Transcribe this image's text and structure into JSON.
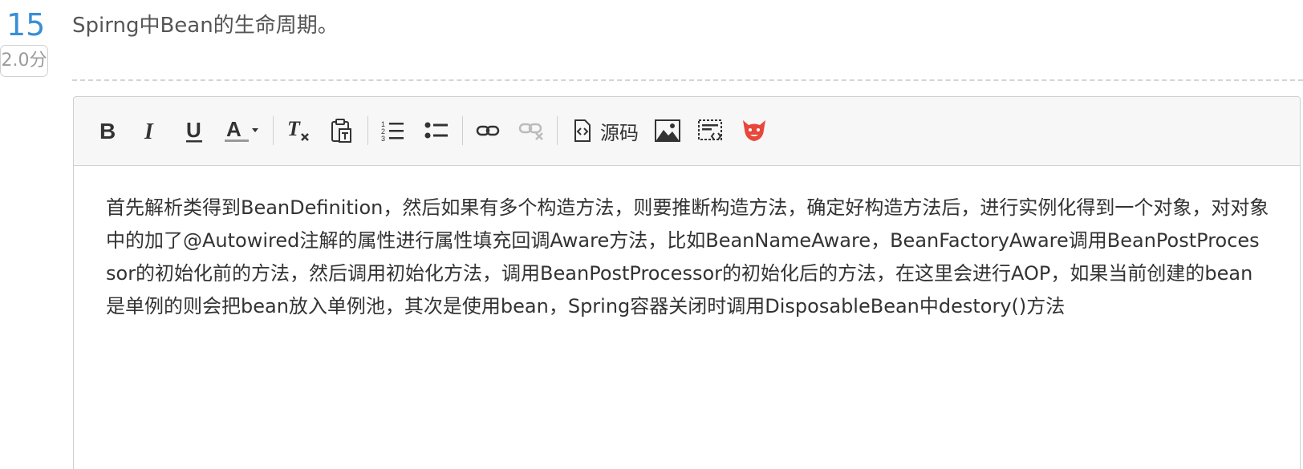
{
  "question": {
    "number": "15",
    "score": "2.0分",
    "title": "Spirng中Bean的生命周期。"
  },
  "toolbar": {
    "source_label": "源码",
    "icons": [
      "bold-icon",
      "italic-icon",
      "underline-icon",
      "font-color-icon",
      "clear-format-icon",
      "paste-text-icon",
      "ordered-list-icon",
      "unordered-list-icon",
      "link-icon",
      "unlink-icon",
      "source-code-icon",
      "image-icon",
      "code-block-icon",
      "emoji-icon"
    ]
  },
  "answer": {
    "text": "首先解析类得到BeanDefinition，然后如果有多个构造方法，则要推断构造方法，确定好构造方法后，进行实例化得到一个对象，对对象中的加了@Autowired注解的属性进行属性填充回调Aware方法，比如BeanNameAware，BeanFactoryAware调用BeanPostProcessor的初始化前的方法，然后调用初始化方法，调用BeanPostProcessor的初始化后的方法，在这里会进行AOP，如果当前创建的bean是单例的则会把bean放入单例池，其次是使用bean，Spring容器关闭时调用DisposableBean中destory()方法"
  },
  "colors": {
    "number": "#3a8ed6",
    "title": "#555555",
    "text": "#333333",
    "toolbar_bg": "#f7f7f7",
    "emoji": "#e8473b"
  }
}
